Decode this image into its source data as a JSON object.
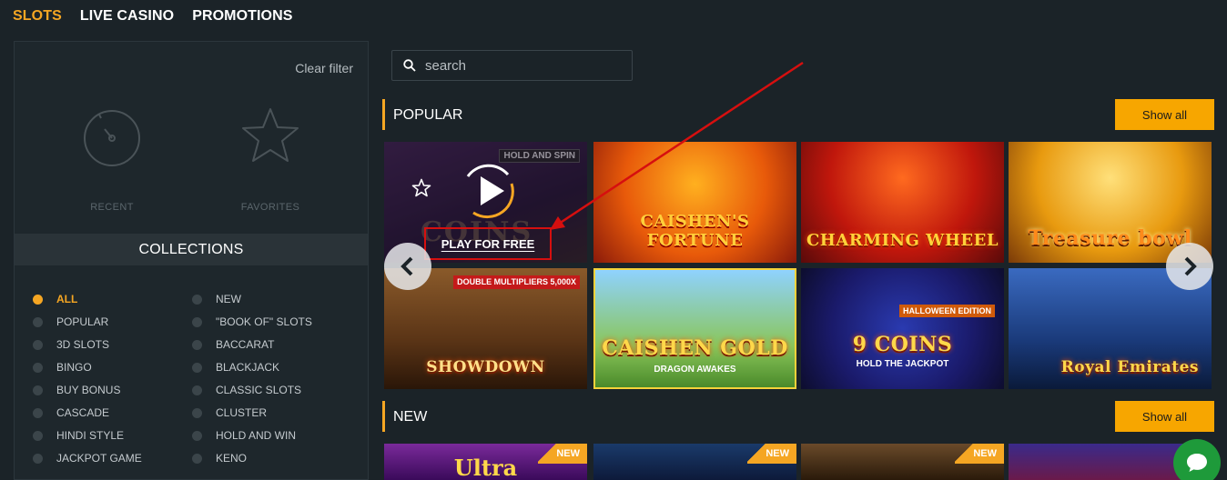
{
  "nav": [
    {
      "label": "SLOTS",
      "active": true
    },
    {
      "label": "LIVE CASINO",
      "active": false
    },
    {
      "label": "PROMOTIONS",
      "active": false
    }
  ],
  "sidebar": {
    "clear_filter": "Clear filter",
    "recent_label": "RECENT",
    "favorites_label": "FAVORITES",
    "collections_title": "COLLECTIONS",
    "collections": [
      {
        "label": "ALL",
        "active": true
      },
      {
        "label": "NEW",
        "active": false
      },
      {
        "label": "POPULAR",
        "active": false
      },
      {
        "label": "\"BOOK OF\" SLOTS",
        "active": false
      },
      {
        "label": "3D SLOTS",
        "active": false
      },
      {
        "label": "BACCARAT",
        "active": false
      },
      {
        "label": "BINGO",
        "active": false
      },
      {
        "label": "BLACKJACK",
        "active": false
      },
      {
        "label": "BUY BONUS",
        "active": false
      },
      {
        "label": "CLASSIC SLOTS",
        "active": false
      },
      {
        "label": "CASCADE",
        "active": false
      },
      {
        "label": "CLUSTER",
        "active": false
      },
      {
        "label": "HINDI STYLE",
        "active": false
      },
      {
        "label": "HOLD AND WIN",
        "active": false
      },
      {
        "label": "JACKPOT GAME",
        "active": false
      },
      {
        "label": "KENO",
        "active": false
      }
    ]
  },
  "search": {
    "placeholder": "search"
  },
  "popular": {
    "title": "POPULAR",
    "show_all": "Show all",
    "play_for_free": "PLAY FOR FREE",
    "games": [
      {
        "name": "COINS",
        "tag": "HOLD AND SPIN"
      },
      {
        "name": "CAISHEN'S FORTUNE"
      },
      {
        "name": "CHARMING WHEEL"
      },
      {
        "name": "Treasure bowl"
      },
      {
        "name": "SHOWDOWN",
        "tag": "DOUBLE MULTIPLIERS 5,000X"
      },
      {
        "name": "CAISHEN GOLD",
        "sub": "DRAGON AWAKES"
      },
      {
        "name": "9 COINS",
        "sub": "HOLD THE JACKPOT",
        "tag": "HALLOWEEN EDITION"
      },
      {
        "name": "Royal Emirates"
      }
    ]
  },
  "new": {
    "title": "NEW",
    "show_all": "Show all",
    "badge": "NEW",
    "games": [
      {
        "name": "Ultra"
      }
    ]
  },
  "colors": {
    "accent": "#f5a623",
    "background": "#1b2328",
    "panel": "#1e272c",
    "annotation": "#d60f0f",
    "chat": "#1e9a3a"
  }
}
